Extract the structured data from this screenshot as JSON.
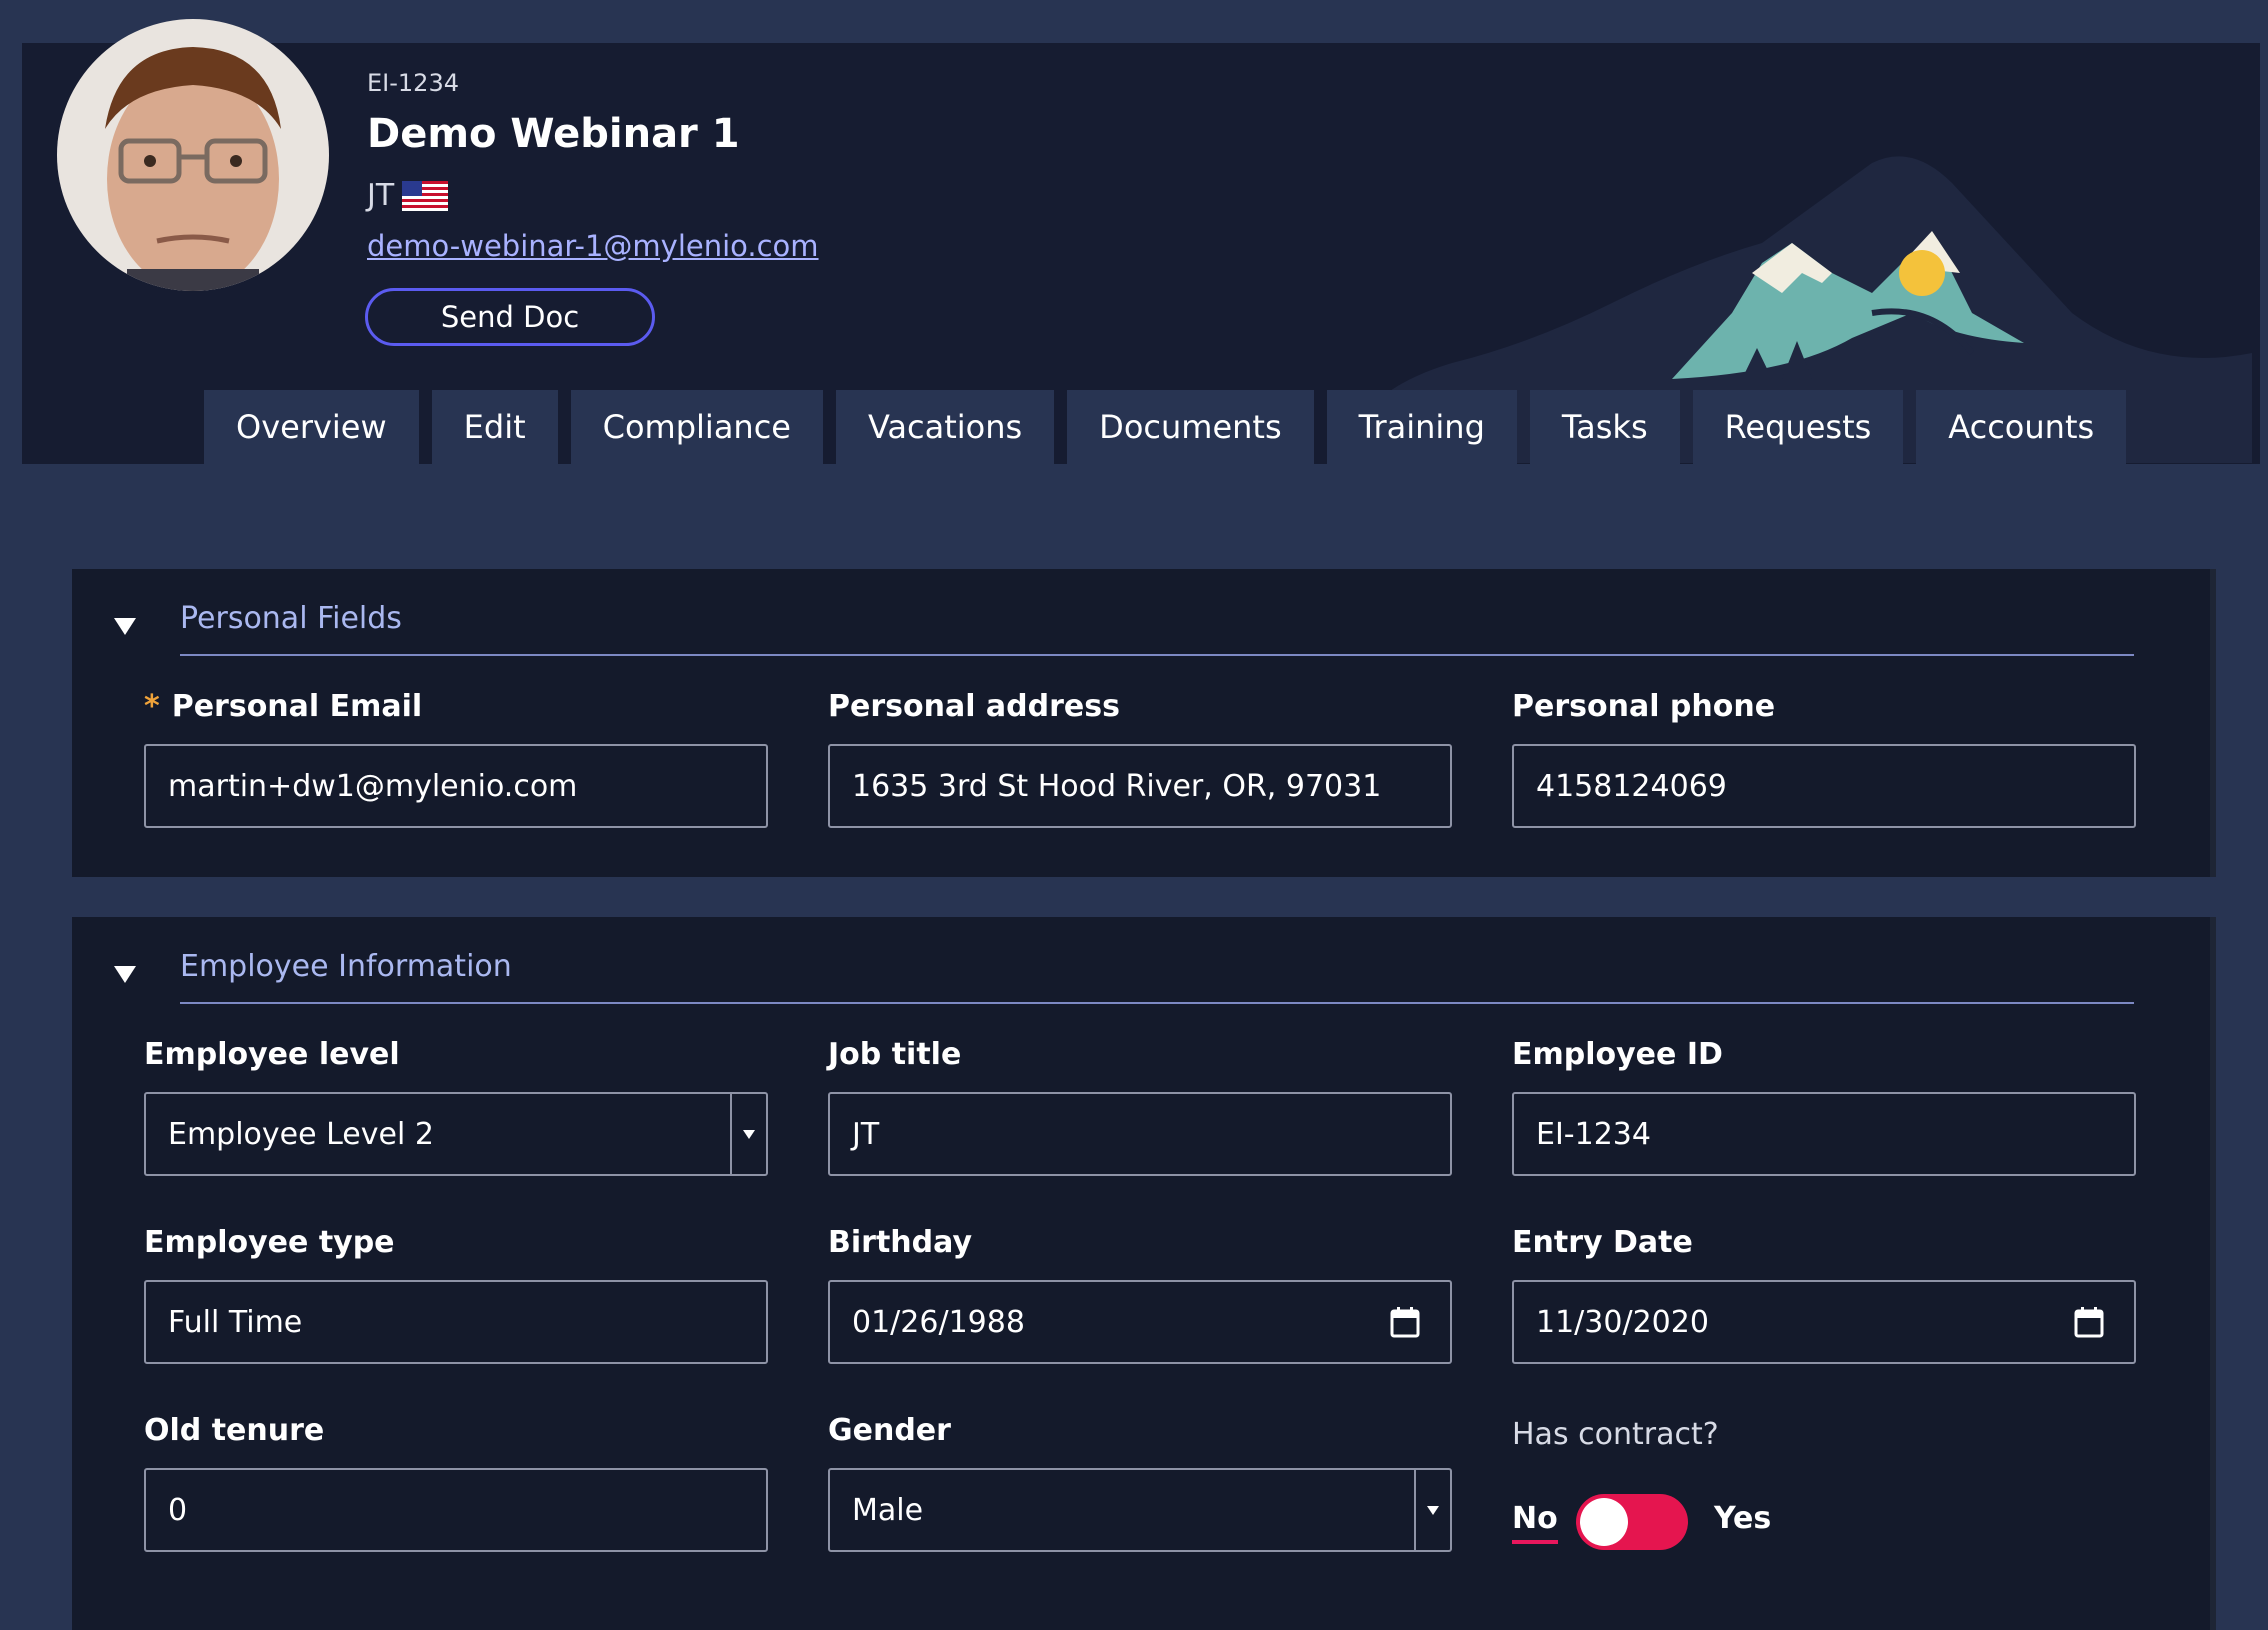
{
  "profile": {
    "employee_code": "EI-1234",
    "name": "Demo Webinar 1",
    "initials": "JT",
    "country_flag": "us-flag-icon",
    "email": "demo-webinar-1@mylenio.com",
    "send_doc_label": "Send Doc"
  },
  "tabs": [
    {
      "label": "Overview",
      "active": false
    },
    {
      "label": "Edit",
      "active": true
    },
    {
      "label": "Compliance",
      "active": false
    },
    {
      "label": "Vacations",
      "active": false
    },
    {
      "label": "Documents",
      "active": false
    },
    {
      "label": "Training",
      "active": false
    },
    {
      "label": "Tasks",
      "active": false
    },
    {
      "label": "Requests",
      "active": false
    },
    {
      "label": "Accounts",
      "active": false
    }
  ],
  "personal": {
    "title": "Personal Fields",
    "email_label": "Personal Email",
    "email_required_mark": "*",
    "email_value": "martin+dw1@mylenio.com",
    "address_label": "Personal address",
    "address_value": "1635 3rd St Hood River, OR, 97031",
    "phone_label": "Personal phone",
    "phone_value": "4158124069"
  },
  "employee": {
    "title": "Employee Information",
    "level_label": "Employee level",
    "level_value": "Employee Level 2",
    "job_title_label": "Job title",
    "job_title_value": "JT",
    "id_label": "Employee ID",
    "id_value": "EI-1234",
    "type_label": "Employee type",
    "type_value": "Full Time",
    "birthday_label": "Birthday",
    "birthday_value": "01/26/1988",
    "entry_label": "Entry Date",
    "entry_value": "11/30/2020",
    "tenure_label": "Old tenure",
    "tenure_value": "0",
    "gender_label": "Gender",
    "gender_value": "Male",
    "contract_label": "Has contract?",
    "contract_no": "No",
    "contract_yes": "Yes",
    "contract_on": false
  },
  "colors": {
    "accent": "#5b5bf0",
    "toggle": "#e5154f",
    "section_title": "#aab8f0",
    "required": "#f0a33a"
  }
}
